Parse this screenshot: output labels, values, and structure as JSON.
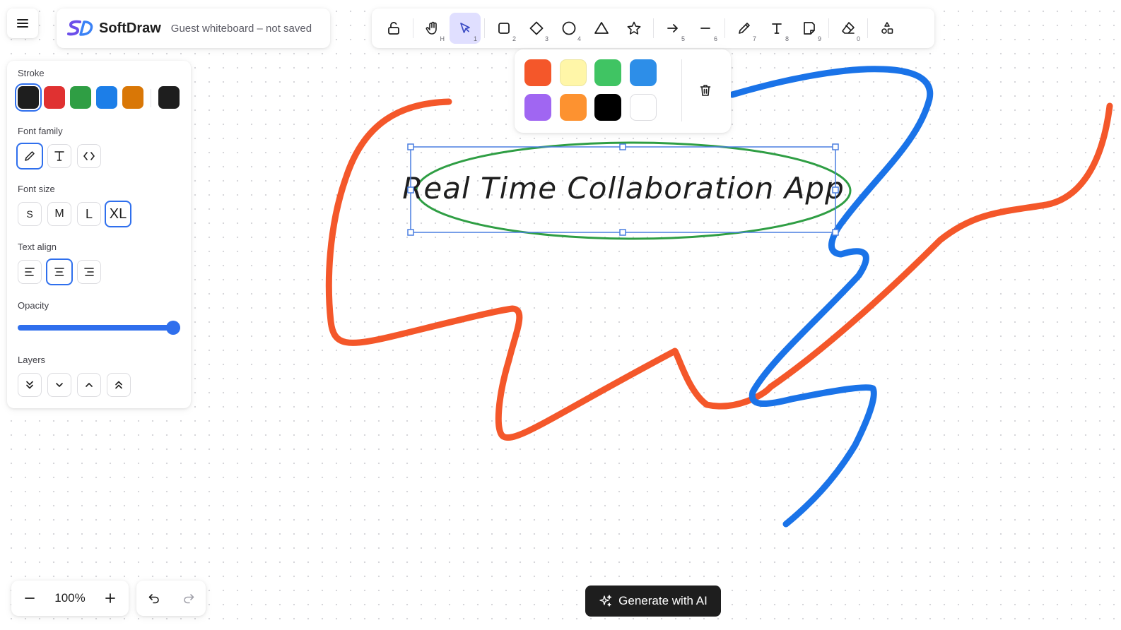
{
  "app": {
    "name": "SoftDraw",
    "subtitle": "Guest whiteboard – not saved"
  },
  "toolbar": {
    "tools": [
      {
        "name": "lock-icon",
        "key": ""
      },
      {
        "name": "hand-icon",
        "key": "H"
      },
      {
        "name": "select-arrow-icon",
        "key": "1",
        "active": true
      },
      {
        "name": "rectangle-icon",
        "key": "2"
      },
      {
        "name": "diamond-icon",
        "key": "3"
      },
      {
        "name": "ellipse-icon",
        "key": "4"
      },
      {
        "name": "triangle-icon",
        "key": ""
      },
      {
        "name": "star-icon",
        "key": ""
      },
      {
        "name": "arrow-icon",
        "key": "5"
      },
      {
        "name": "line-icon",
        "key": "6"
      },
      {
        "name": "pencil-icon",
        "key": "7"
      },
      {
        "name": "text-icon",
        "key": "8"
      },
      {
        "name": "note-icon",
        "key": "9"
      },
      {
        "name": "eraser-icon",
        "key": "0"
      },
      {
        "name": "shapes-library-icon",
        "key": ""
      }
    ]
  },
  "popover": {
    "colors": [
      "#f4572a",
      "#fff6a8",
      "#40c463",
      "#2d8ee8",
      "#a066f2",
      "#fd9230",
      "#000000",
      "#ffffff"
    ]
  },
  "properties": {
    "stroke_label": "Stroke",
    "stroke_colors": [
      "#1e1e1e",
      "#e03131",
      "#2f9e44",
      "#1c7ee8",
      "#d97706"
    ],
    "stroke_current": "#1e1e1e",
    "font_family_label": "Font family",
    "font_size_label": "Font size",
    "font_sizes": [
      "S",
      "M",
      "L",
      "XL"
    ],
    "font_size_selected": "XL",
    "text_align_label": "Text align",
    "opacity_label": "Opacity",
    "opacity_value": 100,
    "layers_label": "Layers"
  },
  "canvas": {
    "title_text": "Real Time Collaboration App",
    "stroke_colors": {
      "orange": "#f4572a",
      "blue": "#1a73e8",
      "green": "#2f9e44",
      "selection": "#4a7fe0"
    }
  },
  "zoom": {
    "value": "100%"
  },
  "ai_button": {
    "label": "Generate with AI"
  }
}
